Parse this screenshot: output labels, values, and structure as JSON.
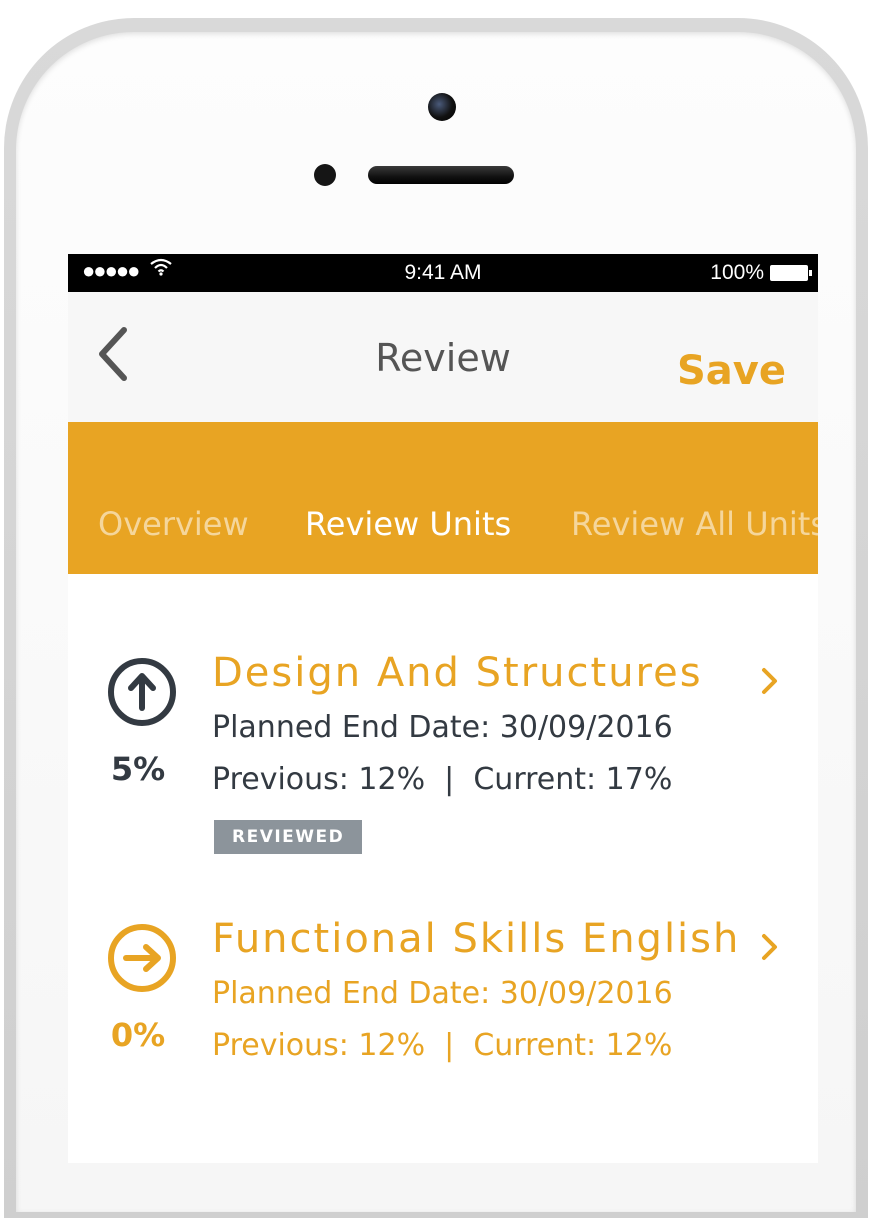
{
  "status_bar": {
    "signal": "●●●●●",
    "time": "9:41 AM",
    "battery": "100%",
    "icons": [
      "signal-dots-icon",
      "wifi-icon",
      "battery-icon"
    ]
  },
  "nav": {
    "title": "Review",
    "save_label": "Save",
    "back_icon": "chevron-left-icon"
  },
  "tabs": [
    {
      "label": "Overview",
      "active": false
    },
    {
      "label": "Review Units",
      "active": true
    },
    {
      "label": "Review All Units",
      "active": false
    }
  ],
  "units": [
    {
      "title": "Design And Structures",
      "percent": "5%",
      "planned_end": "Planned End Date: 30/09/2016",
      "progress": "Previous: 12%  |  Current: 17%",
      "badge": "REVIEWED",
      "icon": "arrow-up-circle-icon",
      "color": "#333a42"
    },
    {
      "title": "Functional Skills English",
      "percent": "0%",
      "planned_end": "Planned End Date: 30/09/2016",
      "progress": "Previous: 12%  |  Current: 12%",
      "icon": "arrow-right-circle-icon",
      "color": "#e8a423"
    }
  ],
  "colors": {
    "accent": "#e8a423",
    "text_dark": "#333a42",
    "badge": "#8c949b"
  }
}
